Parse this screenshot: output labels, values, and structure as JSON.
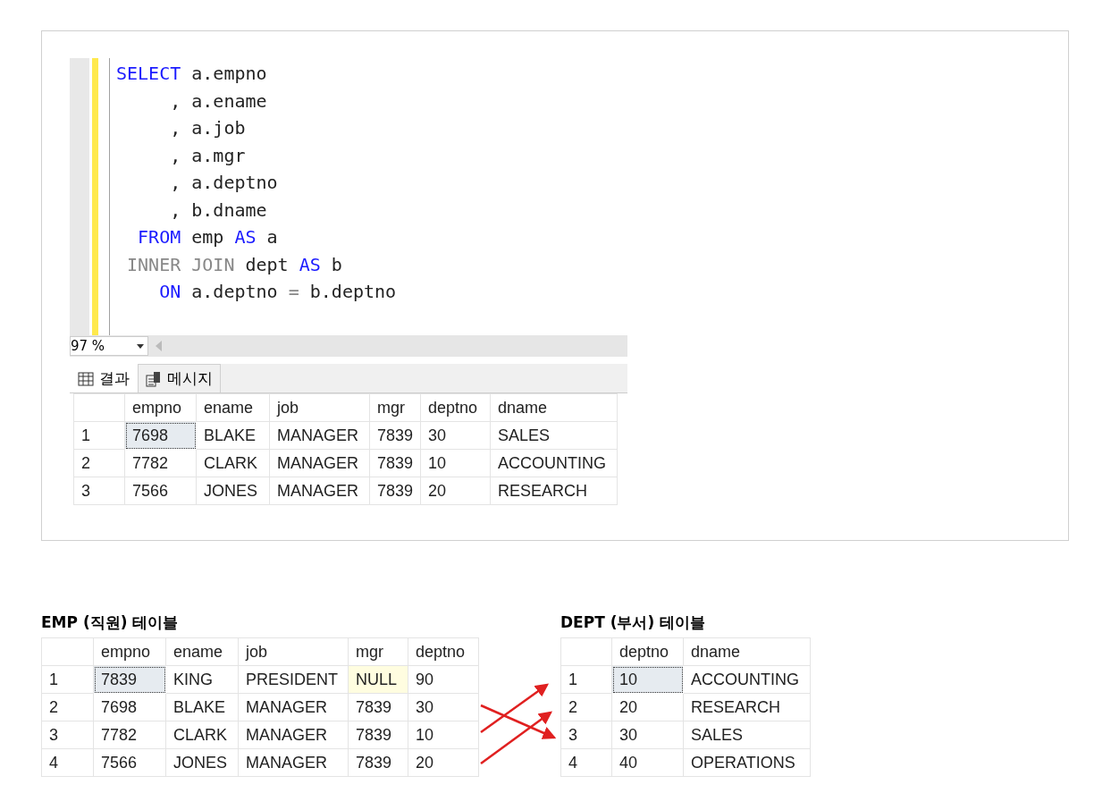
{
  "editor": {
    "lines": [
      [
        {
          "kind": "keyword",
          "text": "SELECT"
        },
        {
          "kind": "text",
          "text": " a.empno"
        }
      ],
      [
        {
          "kind": "text",
          "text": "     , a.ename"
        }
      ],
      [
        {
          "kind": "text",
          "text": "     , a.job"
        }
      ],
      [
        {
          "kind": "text",
          "text": "     , a.mgr"
        }
      ],
      [
        {
          "kind": "text",
          "text": "     , a.deptno"
        }
      ],
      [
        {
          "kind": "text",
          "text": "     , b.dname"
        }
      ],
      [
        {
          "kind": "keyword",
          "text": "  FROM"
        },
        {
          "kind": "text",
          "text": " emp "
        },
        {
          "kind": "keyword",
          "text": "AS"
        },
        {
          "kind": "text",
          "text": " a"
        }
      ],
      [
        {
          "kind": "gray",
          "text": " INNER JOIN"
        },
        {
          "kind": "text",
          "text": " dept "
        },
        {
          "kind": "keyword",
          "text": "AS"
        },
        {
          "kind": "text",
          "text": " b"
        }
      ],
      [
        {
          "kind": "keyword",
          "text": "    ON"
        },
        {
          "kind": "text",
          "text": " a.deptno "
        },
        {
          "kind": "gray",
          "text": "="
        },
        {
          "kind": "text",
          "text": " b.deptno"
        }
      ]
    ],
    "zoom": "97 %"
  },
  "result_tabs": [
    {
      "label": "결과",
      "kind": "grid",
      "selected": true
    },
    {
      "label": "메시지",
      "kind": "message",
      "selected": false
    }
  ],
  "result_grid": {
    "columns": [
      "empno",
      "ename",
      "job",
      "mgr",
      "deptno",
      "dname"
    ],
    "rows": [
      {
        "number": "1",
        "cells": [
          {
            "text": "7698",
            "selected": true,
            "highlighted": false
          },
          {
            "text": "BLAKE",
            "selected": false,
            "highlighted": false
          },
          {
            "text": "MANAGER",
            "selected": false,
            "highlighted": false
          },
          {
            "text": "7839",
            "selected": false,
            "highlighted": false
          },
          {
            "text": "30",
            "selected": false,
            "highlighted": false
          },
          {
            "text": "SALES",
            "selected": false,
            "highlighted": false
          }
        ]
      },
      {
        "number": "2",
        "cells": [
          {
            "text": "7782",
            "selected": false,
            "highlighted": false
          },
          {
            "text": "CLARK",
            "selected": false,
            "highlighted": false
          },
          {
            "text": "MANAGER",
            "selected": false,
            "highlighted": false
          },
          {
            "text": "7839",
            "selected": false,
            "highlighted": false
          },
          {
            "text": "10",
            "selected": false,
            "highlighted": false
          },
          {
            "text": "ACCOUNTING",
            "selected": false,
            "highlighted": false
          }
        ]
      },
      {
        "number": "3",
        "cells": [
          {
            "text": "7566",
            "selected": false,
            "highlighted": false
          },
          {
            "text": "JONES",
            "selected": false,
            "highlighted": false
          },
          {
            "text": "MANAGER",
            "selected": false,
            "highlighted": false
          },
          {
            "text": "7839",
            "selected": false,
            "highlighted": false
          },
          {
            "text": "20",
            "selected": false,
            "highlighted": false
          },
          {
            "text": "RESEARCH",
            "selected": false,
            "highlighted": false
          }
        ]
      }
    ]
  },
  "emp_table": {
    "title": "EMP (직원) 테이블",
    "columns": [
      "empno",
      "ename",
      "job",
      "mgr",
      "deptno"
    ],
    "rows": [
      {
        "number": "1",
        "cells": [
          {
            "text": "7839",
            "selected": true,
            "highlighted": false
          },
          {
            "text": "KING",
            "selected": false,
            "highlighted": false
          },
          {
            "text": "PRESIDENT",
            "selected": false,
            "highlighted": false
          },
          {
            "text": "NULL",
            "selected": false,
            "highlighted": true
          },
          {
            "text": "90",
            "selected": false,
            "highlighted": false
          }
        ]
      },
      {
        "number": "2",
        "cells": [
          {
            "text": "7698",
            "selected": false,
            "highlighted": false
          },
          {
            "text": "BLAKE",
            "selected": false,
            "highlighted": false
          },
          {
            "text": "MANAGER",
            "selected": false,
            "highlighted": false
          },
          {
            "text": "7839",
            "selected": false,
            "highlighted": false
          },
          {
            "text": "30",
            "selected": false,
            "highlighted": false
          }
        ]
      },
      {
        "number": "3",
        "cells": [
          {
            "text": "7782",
            "selected": false,
            "highlighted": false
          },
          {
            "text": "CLARK",
            "selected": false,
            "highlighted": false
          },
          {
            "text": "MANAGER",
            "selected": false,
            "highlighted": false
          },
          {
            "text": "7839",
            "selected": false,
            "highlighted": false
          },
          {
            "text": "10",
            "selected": false,
            "highlighted": false
          }
        ]
      },
      {
        "number": "4",
        "cells": [
          {
            "text": "7566",
            "selected": false,
            "highlighted": false
          },
          {
            "text": "JONES",
            "selected": false,
            "highlighted": false
          },
          {
            "text": "MANAGER",
            "selected": false,
            "highlighted": false
          },
          {
            "text": "7839",
            "selected": false,
            "highlighted": false
          },
          {
            "text": "20",
            "selected": false,
            "highlighted": false
          }
        ]
      }
    ]
  },
  "dept_table": {
    "title": "DEPT (부서) 테이블",
    "columns": [
      "deptno",
      "dname"
    ],
    "rows": [
      {
        "number": "1",
        "cells": [
          {
            "text": "10",
            "selected": true,
            "highlighted": false
          },
          {
            "text": "ACCOUNTING",
            "selected": false,
            "highlighted": false
          }
        ]
      },
      {
        "number": "2",
        "cells": [
          {
            "text": "20",
            "selected": false,
            "highlighted": false
          },
          {
            "text": "RESEARCH",
            "selected": false,
            "highlighted": false
          }
        ]
      },
      {
        "number": "3",
        "cells": [
          {
            "text": "30",
            "selected": false,
            "highlighted": false
          },
          {
            "text": "SALES",
            "selected": false,
            "highlighted": false
          }
        ]
      },
      {
        "number": "4",
        "cells": [
          {
            "text": "40",
            "selected": false,
            "highlighted": false
          },
          {
            "text": "OPERATIONS",
            "selected": false,
            "highlighted": false
          }
        ]
      }
    ]
  }
}
